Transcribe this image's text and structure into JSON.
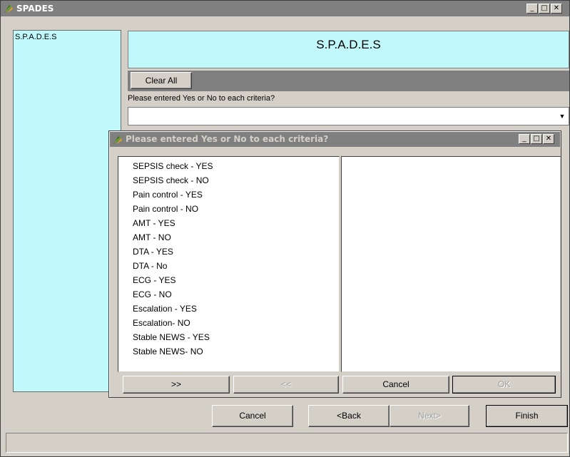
{
  "window": {
    "title": "SPADES"
  },
  "left_panel": {
    "text": "S.P.A.D.E.S"
  },
  "header": {
    "title": "S.P.A.D.E.S"
  },
  "toolbar": {
    "clear_all_label": "Clear All"
  },
  "question": {
    "label": "Please entered Yes or No to each criteria?",
    "combo_value": ""
  },
  "dialog": {
    "title": "Please entered Yes or No to each criteria?",
    "available_items": [
      "SEPSIS check - YES",
      "SEPSIS check - NO",
      "Pain control - YES",
      "Pain control - NO",
      "AMT - YES",
      "AMT - NO",
      "DTA - YES",
      "DTA - No",
      "ECG - YES",
      "ECG - NO",
      "Escalation - YES",
      "Escalation- NO",
      "Stable NEWS - YES",
      "Stable NEWS- NO"
    ],
    "selected_items": [],
    "add_label": ">>",
    "remove_label": "<<",
    "cancel_label": "Cancel",
    "ok_label": "OK"
  },
  "wizard": {
    "cancel_label": "Cancel",
    "back_label": "<Back",
    "next_label": "Next>",
    "finish_label": "Finish"
  },
  "colors": {
    "panel_cyan": "#c0f8fb",
    "chrome_gray": "#d4d0c8",
    "titlebar_gray": "#808080"
  },
  "icons": {
    "app": "spades-app-icon"
  }
}
